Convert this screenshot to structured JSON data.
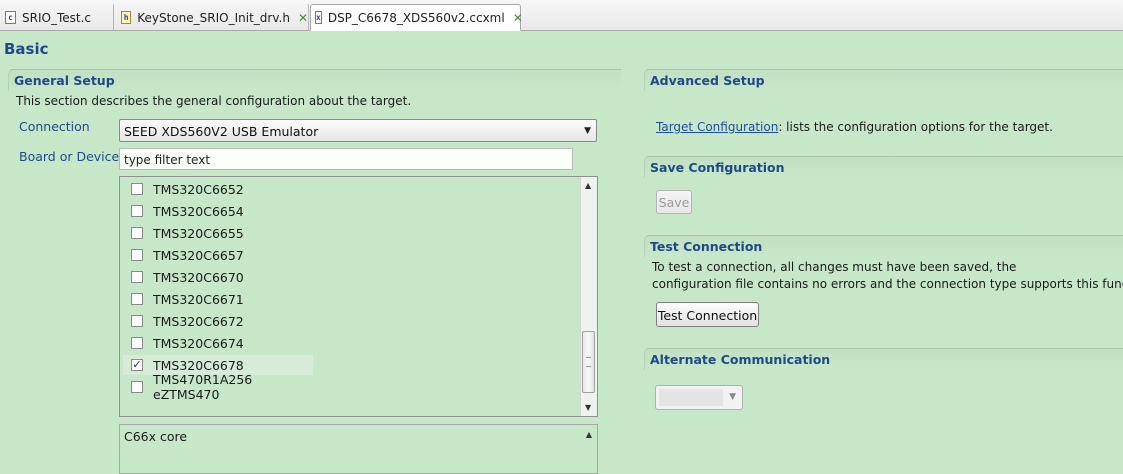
{
  "tabs": [
    {
      "label": "SRIO_Test.c",
      "icon": "c-source-file-icon"
    },
    {
      "label": "KeyStone_SRIO_Init_drv.h",
      "icon": "header-file-icon"
    },
    {
      "label": "DSP_C6678_XDS560v2.ccxml",
      "icon": "ccxml-file-icon"
    }
  ],
  "page": {
    "title": "Basic"
  },
  "general_setup": {
    "title": "General Setup",
    "description": "This section describes the general configuration about the target.",
    "connection_label": "Connection",
    "connection_value": "SEED XDS560V2 USB Emulator",
    "board_label": "Board or Device",
    "filter_text": "type filter text",
    "devices": [
      {
        "name": "TMS320C6652",
        "checked": false
      },
      {
        "name": "TMS320C6654",
        "checked": false
      },
      {
        "name": "TMS320C6655",
        "checked": false
      },
      {
        "name": "TMS320C6657",
        "checked": false
      },
      {
        "name": "TMS320C6670",
        "checked": false
      },
      {
        "name": "TMS320C6671",
        "checked": false
      },
      {
        "name": "TMS320C6672",
        "checked": false
      },
      {
        "name": "TMS320C6674",
        "checked": false
      },
      {
        "name": "TMS320C6678",
        "checked": true
      },
      {
        "name": "TMS470R1A256 eZTMS470",
        "checked": false
      }
    ],
    "core_description": "C66x core"
  },
  "advanced_setup": {
    "title": "Advanced Setup",
    "link_text": "Target Configuration",
    "link_suffix": ": lists the configuration options for the target."
  },
  "save_configuration": {
    "title": "Save Configuration",
    "save_label": "Save"
  },
  "test_connection": {
    "title": "Test Connection",
    "line1": "To test a connection, all changes must have been saved, the",
    "line2": "configuration file contains no errors and the connection type supports this functi",
    "button_label": "Test Connection"
  },
  "alternate_communication": {
    "title": "Alternate Communication",
    "value": ""
  },
  "colors": {
    "background": "#c7e8c8",
    "heading": "#1f4a8a",
    "link": "#1f4ea0"
  }
}
